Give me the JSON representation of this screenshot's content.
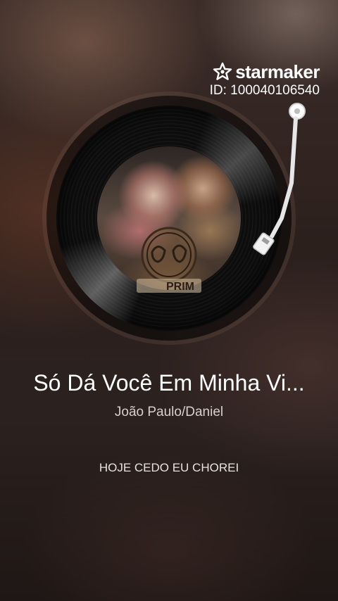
{
  "watermark": {
    "brand": "starmaker",
    "id_text": "ID: 100040106540",
    "icon": "star-logo-icon"
  },
  "player": {
    "song_title": "Só Dá Você Em Minha Vi...",
    "artist": "João Paulo/Daniel",
    "lyric_line": "HOJE CEDO EU CHOREI",
    "album_label_text": "PRIM"
  },
  "colors": {
    "background": "#2a1f1c",
    "title_text": "#ffffff",
    "artist_text": "#d8d0cc",
    "vinyl": "#0d0d0d",
    "tonearm": "#e6e6e6"
  }
}
